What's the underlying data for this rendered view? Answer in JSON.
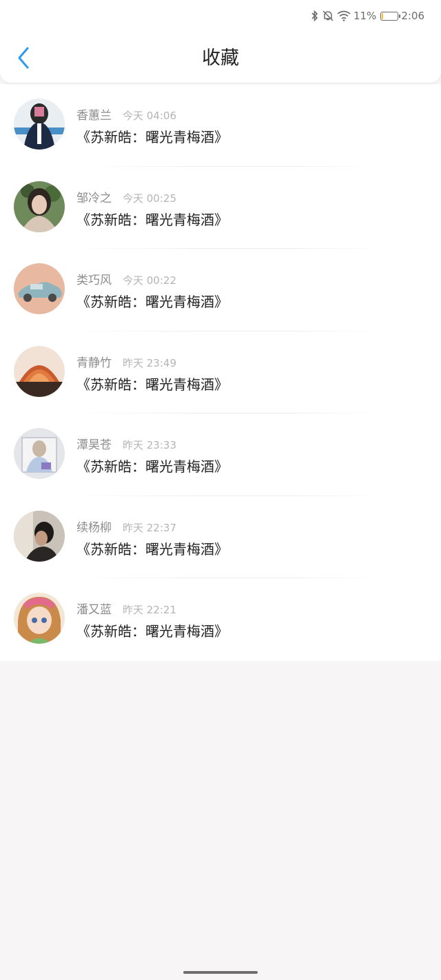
{
  "status_bar": {
    "battery_percent_text": "11%",
    "battery_level": 0.11,
    "time": "2:06",
    "icons": [
      "bluetooth-icon",
      "mute-bell-icon",
      "wifi-icon",
      "battery-icon"
    ]
  },
  "header": {
    "title": "收藏",
    "back_icon": "chevron-left-icon",
    "accent_color": "#2b9cf2"
  },
  "favorites": [
    {
      "user": "香蕙兰",
      "time": "今天 04:06",
      "title": "《苏新皓：曙光青梅酒》"
    },
    {
      "user": "邹冷之",
      "time": "今天 00:25",
      "title": "《苏新皓：曙光青梅酒》"
    },
    {
      "user": "类巧风",
      "time": "今天 00:22",
      "title": "《苏新皓：曙光青梅酒》"
    },
    {
      "user": "青静竹",
      "time": "昨天 23:49",
      "title": "《苏新皓：曙光青梅酒》"
    },
    {
      "user": "潭昊苍",
      "time": "昨天 23:33",
      "title": "《苏新皓：曙光青梅酒》"
    },
    {
      "user": "续杨柳",
      "time": "昨天 22:37",
      "title": "《苏新皓：曙光青梅酒》"
    },
    {
      "user": "潘又蓝",
      "time": "昨天 22:21",
      "title": "《苏新皓：曙光青梅酒》"
    }
  ]
}
